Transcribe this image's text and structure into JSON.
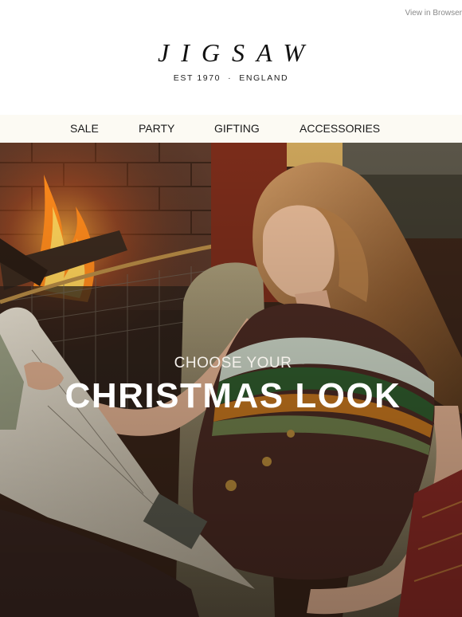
{
  "header": {
    "view_in_browser": "View in Browser",
    "logo": "JIGSAW",
    "tagline_left": "EST 1970",
    "tagline_sep": "·",
    "tagline_right": "ENGLAND"
  },
  "nav": {
    "items": [
      {
        "label": "SALE"
      },
      {
        "label": "PARTY"
      },
      {
        "label": "GIFTING"
      },
      {
        "label": "ACCESSORIES"
      }
    ],
    "background": "#fcfaf3"
  },
  "hero": {
    "kicker": "CHOOSE YOUR",
    "headline": "CHRISTMAS LOOK",
    "image": "woman-reading-newspaper-by-fireplace-photo",
    "text_color": "#ffffff"
  }
}
